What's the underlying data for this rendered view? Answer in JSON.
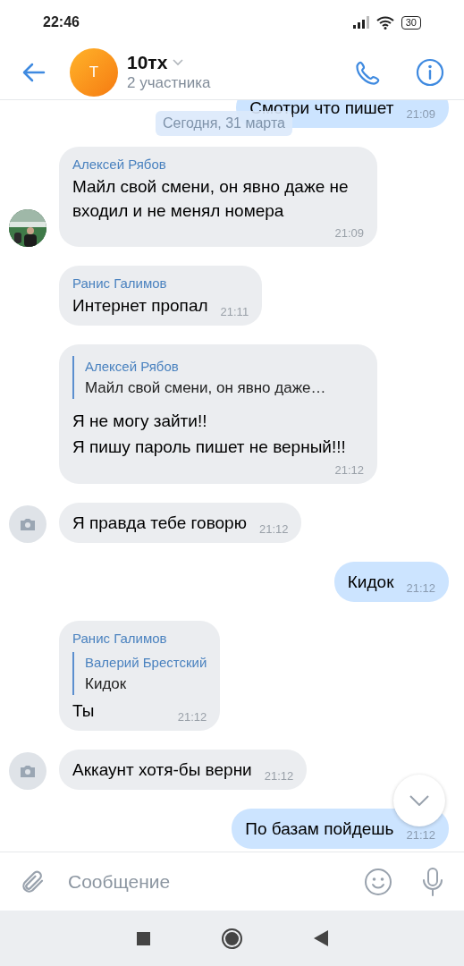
{
  "status_bar": {
    "time": "22:46",
    "battery": "30"
  },
  "header": {
    "avatar_letter": "T",
    "title": "10тх",
    "subtitle": "2 участника"
  },
  "date_pill": "Сегодня, 31 марта",
  "messages": [
    {
      "kind": "outgoing",
      "text": "Смотри что пишет",
      "time": "21:09"
    },
    {
      "kind": "incoming",
      "sender": "Алексей Рябов",
      "text": "Майл свой смени, он явно даже не входил и не менял номера",
      "time": "21:09"
    },
    {
      "kind": "incoming",
      "sender": "Ранис Галимов",
      "text": "Интернет пропал",
      "time": "21:11"
    },
    {
      "kind": "incoming",
      "reply": {
        "sender": "Алексей Рябов",
        "text": "Майл свой смени, он явно даже…"
      },
      "lines": [
        "Я не могу зайти!!",
        "Я пишу пароль пишет не верный!!!"
      ],
      "time": "21:12"
    },
    {
      "kind": "incoming",
      "avatar": {
        "kind": "camera"
      },
      "text": "Я правда тебе говорю",
      "time": "21:12"
    },
    {
      "kind": "outgoing",
      "text": "Кидок",
      "time": "21:12"
    },
    {
      "kind": "incoming",
      "sender": "Ранис Галимов",
      "reply": {
        "sender": "Валерий Брестский",
        "text": "Кидок"
      },
      "text": "Ты",
      "time": "21:12"
    },
    {
      "kind": "incoming",
      "avatar": {
        "kind": "camera"
      },
      "text": "Аккаунт хотя-бы верни",
      "time": "21:12"
    },
    {
      "kind": "outgoing",
      "text": "По базам пойдешь",
      "time": "21:12"
    }
  ],
  "composer": {
    "placeholder": "Сообщение"
  }
}
